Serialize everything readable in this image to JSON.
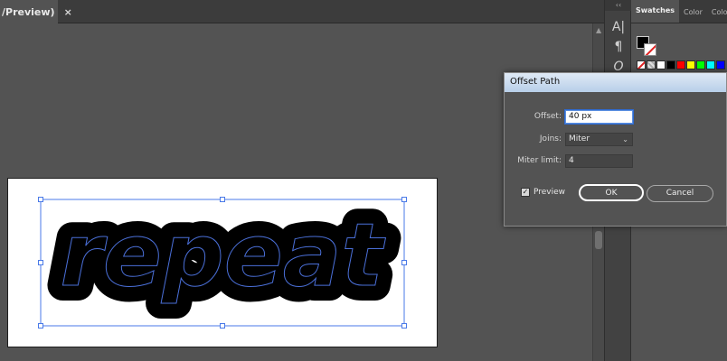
{
  "document": {
    "tab_title": "/Preview)",
    "close_label": "×"
  },
  "artwork": {
    "text": "repeat"
  },
  "tools": {
    "collapse_label": "‹‹",
    "character_glyph": "A|",
    "paragraph_glyph": "¶",
    "opentype_glyph": "O"
  },
  "panel": {
    "tabs": [
      "Swatches",
      "Color",
      "Color"
    ],
    "swatch_colors": [
      "none",
      "registration",
      "#ffffff",
      "#000000",
      "#ff0000",
      "#ffff00",
      "#00ff00",
      "#00ffff",
      "#0000ff"
    ]
  },
  "dialog": {
    "title": "Offset Path",
    "offset_label": "Offset:",
    "offset_value": "40 px",
    "joins_label": "Joins:",
    "joins_value": "Miter",
    "miter_label": "Miter limit:",
    "miter_value": "4",
    "preview_label": "Preview",
    "preview_checked": true,
    "ok_label": "OK",
    "cancel_label": "Cancel"
  }
}
